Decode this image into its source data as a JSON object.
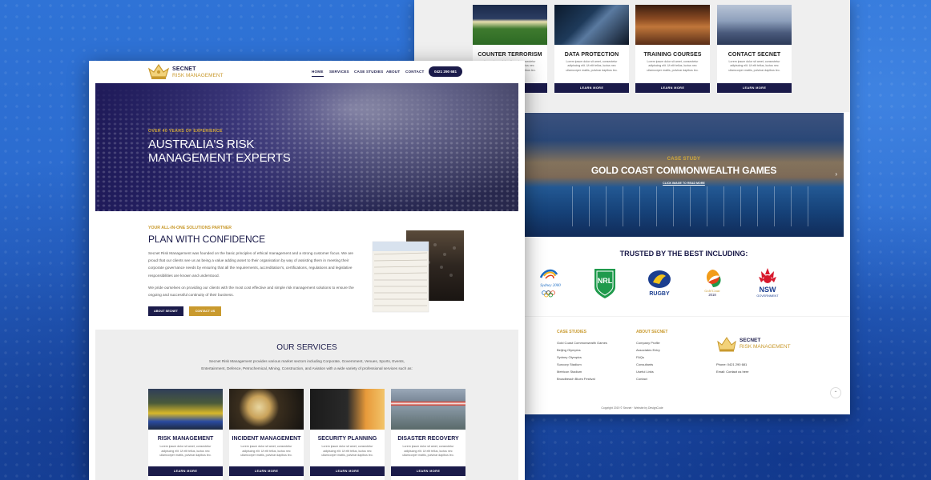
{
  "colors": {
    "navy": "#1b1b4a",
    "gold": "#c99a2e",
    "background_blue": "#2d6fd3"
  },
  "brand": {
    "name": "SECNET",
    "sub": "RISK MANAGEMENT",
    "icon": "crown-logo-icon"
  },
  "nav": {
    "items": [
      {
        "label": "HOME",
        "active": true
      },
      {
        "label": "SERVICES"
      },
      {
        "label": "CASE STUDIES"
      },
      {
        "label": "ABOUT"
      },
      {
        "label": "CONTACT"
      }
    ],
    "phone": "0421 290 681"
  },
  "hero": {
    "kicker": "OVER 40 YEARS OF EXPERIENCE",
    "title": "AUSTRALIA'S RISK MANAGEMENT EXPERTS"
  },
  "about": {
    "kicker": "YOUR ALL-IN-ONE SOLUTIONS PARTNER",
    "title": "PLAN WITH CONFIDENCE",
    "p1": "Secnet Risk Management was founded on the basic principles of ethical management and a strong customer focus. We are proud that our clients see us as being a value adding asset to their organisation by way of assisting them in meeting their corporate governance needs by ensuring that all the requirements, accreditation's, certifications, regulations and legislative responsibilities are known and understood.",
    "p2": "We pride ourselves on providing our clients with the most cost effective and simple risk management solutions to ensure the ongoing and successful continuity of their business.",
    "btn_about": "ABOUT SECNET",
    "btn_contact": "CONTACT US"
  },
  "services": {
    "title": "OUR SERVICES",
    "description": "Secnet Risk Management provides various market sectors including Corporate, Government, Venues, Sports, Events, Entertainment, Defence, Petrochemical, Mining, Construction, and Aviation with a wide variety of professional services such as:",
    "card_text": "Lorem ipsum dolor sit amet, consectetur adipiscing elit. Ut elit tellus, luctus nec ullamcorper mattis, pulvinar dapibus leo.",
    "learn_more": "LEARN MORE",
    "cards_front": [
      {
        "title": "RISK MANAGEMENT"
      },
      {
        "title": "INCIDENT MANAGEMENT"
      },
      {
        "title": "SECURITY PLANNING"
      },
      {
        "title": "DISASTER RECOVERY"
      }
    ],
    "cards_back": [
      {
        "title": "COUNTER TERRORISM"
      },
      {
        "title": "DATA PROTECTION"
      },
      {
        "title": "TRAINING COURSES"
      },
      {
        "title": "CONTACT SECNET"
      }
    ]
  },
  "case_study": {
    "kicker": "CASE STUDY",
    "title": "GOLD COAST COMMONWEALTH GAMES",
    "link": "CLICK IMAGE TO READ MORE"
  },
  "trusted": {
    "title": "TRUSTED BY THE BEST INCLUDING:",
    "logos": [
      {
        "name": "sydney-2000-logo",
        "text": "Sydney 2000"
      },
      {
        "name": "nrl-logo",
        "text": "NRL"
      },
      {
        "name": "rugby-logo",
        "text": "RUGBY"
      },
      {
        "name": "gold-coast-2018-logo",
        "text": "Gold Coast 2018"
      },
      {
        "name": "nsw-government-logo",
        "text": "NSW",
        "sub": "GOVERNMENT"
      }
    ]
  },
  "footer": {
    "case_studies_title": "CASE STUDIES",
    "case_studies": [
      "Gold Coast Commonwealth Games",
      "Beijing Olympics",
      "Sydney Olympics",
      "Suncorp Stadium",
      "Metricon Stadium",
      "Broadbeach Blues Festival"
    ],
    "about_title": "ABOUT SECNET",
    "about_items": [
      "Company Profile",
      "Associates Entry",
      "FAQs",
      "Consultants",
      "Useful Links",
      "Contact"
    ],
    "phone_line": "Phone: 0421 290 681",
    "email_line": "Email: Contact us here",
    "copyright": "Copyright 2019 © Secnet · Website by DesignCode"
  }
}
